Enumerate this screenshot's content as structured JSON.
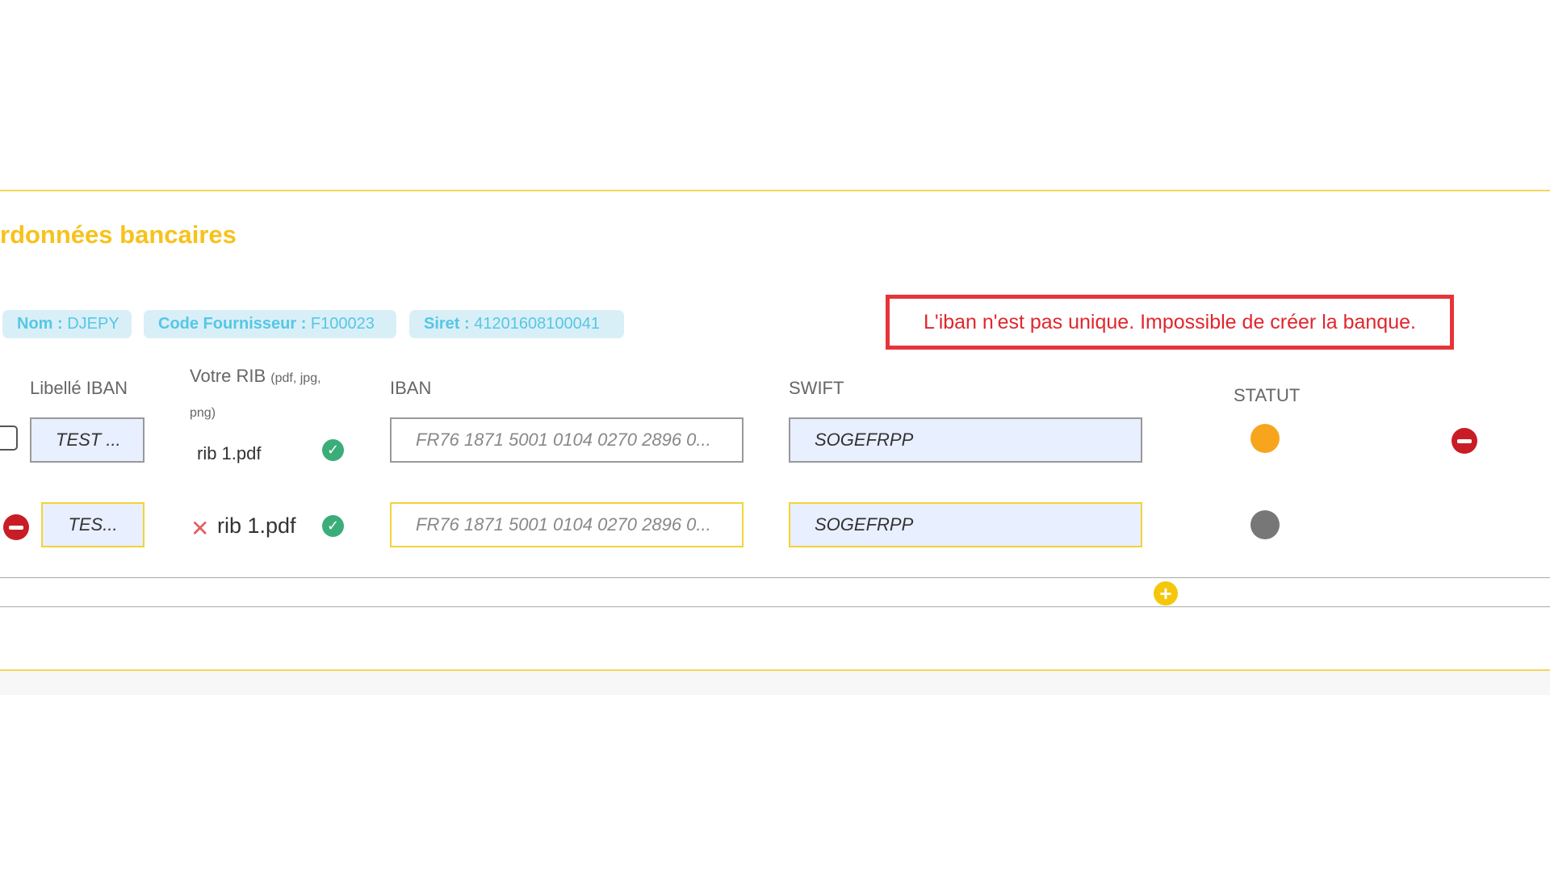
{
  "section": {
    "title": "rdonnées bancaires"
  },
  "supplier": {
    "nom_label": "Nom :",
    "nom_value": "DJEPY",
    "code_label": "Code Fournisseur :",
    "code_value": "F100023",
    "siret_label": "Siret :",
    "siret_value": "41201608100041"
  },
  "error": {
    "message": "L'iban n'est pas unique. Impossible de créer la banque."
  },
  "columns": {
    "libelle": "Libellé IBAN",
    "rib": "Votre RIB",
    "rib_formats": "(pdf, jpg, png)",
    "iban": "IBAN",
    "swift": "SWIFT",
    "statut": "STATUT"
  },
  "rows": [
    {
      "libelle": "TEST ...",
      "rib_file": "rib 1.pdf",
      "iban": "FR76 1871 5001 0104 0270 2896 0...",
      "swift": "SOGEFRPP",
      "status_color": "#f8a51e"
    },
    {
      "libelle": "TES...",
      "rib_file": "rib 1.pdf",
      "iban": "FR76 1871 5001 0104 0270 2896 0...",
      "swift": "SOGEFRPP",
      "status_color": "#777777"
    }
  ],
  "icons": {
    "check": "✓",
    "remove_file": "✕",
    "add": "+"
  },
  "colors": {
    "accent": "#f7c21c",
    "error": "#e1262d",
    "badge_text": "#55c7e6",
    "valid": "#3aad78",
    "remove": "#c81d24"
  }
}
